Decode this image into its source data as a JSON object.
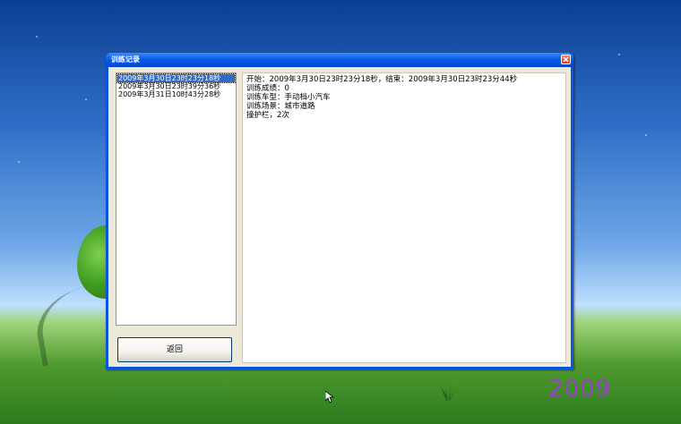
{
  "window": {
    "title": "训练记录",
    "list": {
      "items": [
        "2009年3月30日23时23分18秒",
        "2009年3月30日23时39分36秒",
        "2009年3月31日10时43分28秒"
      ],
      "selected_index": 0
    },
    "back_button": "返回",
    "detail": {
      "line1": "开始：2009年3月30日23时23分18秒，结束：2009年3月30日23时23分44秒",
      "line2": "训练成绩：0",
      "line3": "训练车型：手动档小汽车",
      "line4": "训练场景：城市道路",
      "line5": "撞护栏，2次"
    }
  },
  "desktop": {
    "year_text": "2009"
  },
  "colors": {
    "titlebar": "#0a5ce6",
    "selection": "#316ac5",
    "year": "#9b3fc8"
  }
}
